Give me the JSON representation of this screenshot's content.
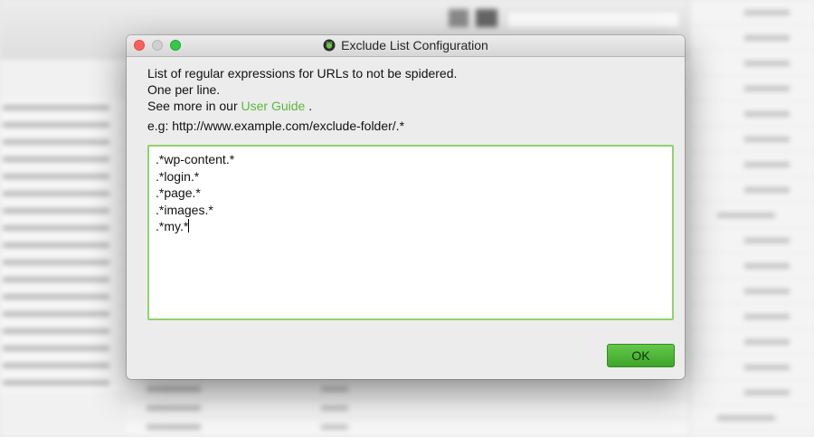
{
  "dialog": {
    "title": "Exclude List Configuration",
    "app_icon": "spider-frog-icon",
    "description_line1": "List of regular expressions for URLs to not be spidered.",
    "description_line2": "One per line.",
    "guide_prefix": "See more in our",
    "guide_link": "User Guide",
    "guide_suffix": ".",
    "example": "e.g: http://www.example.com/exclude-folder/.*",
    "patterns": [
      ".*wp-content.*",
      ".*login.*",
      ".*page.*",
      ".*images.*",
      ".*my.*"
    ],
    "ok_label": "OK"
  },
  "colors": {
    "accent_green": "#5bb83a",
    "ok_button": "#4cb535",
    "editor_focus_border": "#8fd36a",
    "close_button": "#fc605c",
    "zoom_button": "#34c84a"
  }
}
